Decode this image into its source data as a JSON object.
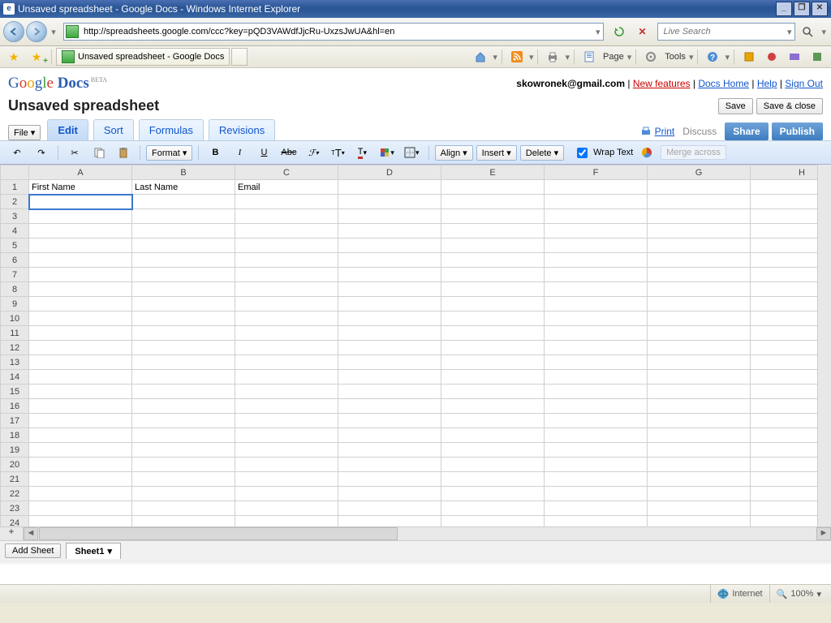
{
  "window": {
    "title": "Unsaved spreadsheet - Google Docs - Windows Internet Explorer"
  },
  "nav": {
    "url": "http://spreadsheets.google.com/ccc?key=pQD3VAWdfJjcRu-UxzsJwUA&hl=en",
    "search_placeholder": "Live Search"
  },
  "ie_tab": {
    "label": "Unsaved spreadsheet - Google Docs"
  },
  "ie_tools": {
    "page": "Page",
    "tools": "Tools"
  },
  "gdocs": {
    "logo_docs": "Docs",
    "logo_beta": "BETA",
    "email": "skowronek@gmail.com",
    "new_features": "New features",
    "docs_home": "Docs Home",
    "help": "Help",
    "sign_out": "Sign Out",
    "doc_title": "Unsaved spreadsheet",
    "save": "Save",
    "save_close": "Save & close",
    "file": "File",
    "tabs": {
      "edit": "Edit",
      "sort": "Sort",
      "formulas": "Formulas",
      "revisions": "Revisions"
    },
    "print": "Print",
    "discuss": "Discuss",
    "share": "Share",
    "publish": "Publish"
  },
  "toolbar": {
    "format": "Format",
    "align": "Align",
    "insert": "Insert",
    "delete": "Delete",
    "wrap": "Wrap Text",
    "merge": "Merge across"
  },
  "sheet": {
    "columns": [
      "A",
      "B",
      "C",
      "D",
      "E",
      "F",
      "G",
      "H"
    ],
    "row1": {
      "A": "First Name",
      "B": "Last Name",
      "C": "Email"
    },
    "rows": 25,
    "selected_cell": "A2",
    "add_sheet": "Add Sheet",
    "tab": "Sheet1"
  },
  "status": {
    "zone": "Internet",
    "zoom": "100%"
  }
}
